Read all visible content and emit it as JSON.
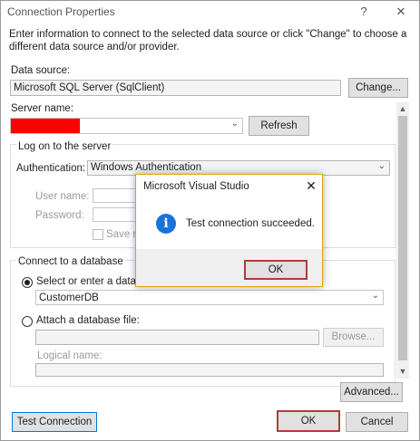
{
  "window": {
    "title": "Connection Properties",
    "help_label": "?",
    "close_label": "✕"
  },
  "description": "Enter information to connect to the selected data source or click \"Change\" to choose a different data source and/or provider.",
  "data_source": {
    "label": "Data source:",
    "value": "Microsoft SQL Server (SqlClient)",
    "change_label": "Change..."
  },
  "server": {
    "label": "Server name:",
    "value": "",
    "refresh_label": "Refresh",
    "redaction_color": "#ff0000"
  },
  "logon": {
    "group_label": "Log on to the server",
    "auth_label": "Authentication:",
    "auth_value": "Windows Authentication",
    "username_label": "User name:",
    "password_label": "Password:",
    "save_label": "Save my password"
  },
  "database": {
    "group_label": "Connect to a database",
    "select_label": "Select or enter a database name:",
    "db_value": "CustomerDB",
    "attach_label": "Attach a database file:",
    "browse_label": "Browse...",
    "logical_label": "Logical name:"
  },
  "footer": {
    "advanced_label": "Advanced...",
    "test_label": "Test Connection",
    "ok_label": "OK",
    "cancel_label": "Cancel"
  },
  "modal": {
    "title": "Microsoft Visual Studio",
    "close_label": "✕",
    "icon_glyph": "i",
    "message": "Test connection succeeded.",
    "ok_label": "OK"
  },
  "colors": {
    "highlight": "#b03a3a",
    "info_icon": "#1a73d9",
    "modal_border": "#e0a600"
  }
}
